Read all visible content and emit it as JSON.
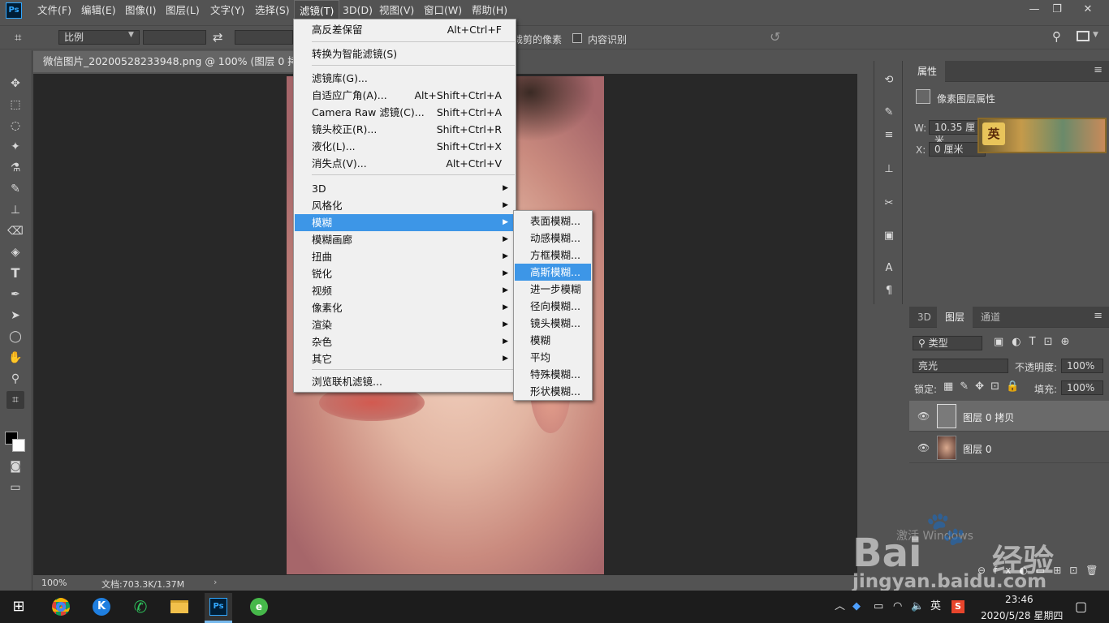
{
  "app": {
    "logo": "Ps"
  },
  "menubar": {
    "items": [
      "文件(F)",
      "编辑(E)",
      "图像(I)",
      "图层(L)",
      "文字(Y)",
      "选择(S)",
      "滤镜(T)",
      "3D(D)",
      "视图(V)",
      "窗口(W)",
      "帮助(H)"
    ]
  },
  "window_controls": {
    "minimize": "—",
    "restore": "❐",
    "close": "✕"
  },
  "options_bar": {
    "ratio_select": "比例",
    "swap_icon": "⇄",
    "delete_pixels_label": "删除裁剪的像素",
    "content_aware_label": "内容识别"
  },
  "document": {
    "tab_title": "微信图片_20200528233948.png @ 100% (图层 0 拷贝, R",
    "zoom": "100%",
    "doc_size": "文档:703.3K/1.37M"
  },
  "filter_menu": {
    "items": [
      {
        "label": "高反差保留",
        "shortcut": "Alt+Ctrl+F"
      },
      {
        "label": "转换为智能滤镜(S)",
        "shortcut": ""
      },
      {
        "label": "滤镜库(G)...",
        "shortcut": ""
      },
      {
        "label": "自适应广角(A)...",
        "shortcut": "Alt+Shift+Ctrl+A"
      },
      {
        "label": "Camera Raw 滤镜(C)...",
        "shortcut": "Shift+Ctrl+A"
      },
      {
        "label": "镜头校正(R)...",
        "shortcut": "Shift+Ctrl+R"
      },
      {
        "label": "液化(L)...",
        "shortcut": "Shift+Ctrl+X"
      },
      {
        "label": "消失点(V)...",
        "shortcut": "Alt+Ctrl+V"
      },
      {
        "label": "3D",
        "submenu": true
      },
      {
        "label": "风格化",
        "submenu": true
      },
      {
        "label": "模糊",
        "submenu": true
      },
      {
        "label": "模糊画廊",
        "submenu": true
      },
      {
        "label": "扭曲",
        "submenu": true
      },
      {
        "label": "锐化",
        "submenu": true
      },
      {
        "label": "视频",
        "submenu": true
      },
      {
        "label": "像素化",
        "submenu": true
      },
      {
        "label": "渲染",
        "submenu": true
      },
      {
        "label": "杂色",
        "submenu": true
      },
      {
        "label": "其它",
        "submenu": true
      },
      {
        "label": "浏览联机滤镜...",
        "shortcut": ""
      }
    ]
  },
  "blur_submenu": {
    "items": [
      "表面模糊...",
      "动感模糊...",
      "方框模糊...",
      "高斯模糊...",
      "进一步模糊",
      "径向模糊...",
      "镜头模糊...",
      "模糊",
      "平均",
      "特殊模糊...",
      "形状模糊..."
    ]
  },
  "properties_panel": {
    "tab": "属性",
    "title": "像素图层属性",
    "w_label": "W:",
    "w_value": "10.35 厘米",
    "x_label": "X:",
    "x_value": "0 厘米",
    "ad_text": "英"
  },
  "layers_panel": {
    "tabs": [
      "3D",
      "图层",
      "通道"
    ],
    "filter_kind": "类型",
    "blend_mode": "亮光",
    "opacity_label": "不透明度:",
    "opacity_value": "100%",
    "lock_label": "锁定:",
    "fill_label": "填充:",
    "fill_value": "100%",
    "layers": [
      {
        "name": "图层 0 拷贝",
        "selected": true
      },
      {
        "name": "图层 0",
        "selected": false
      }
    ]
  },
  "watermark": {
    "activate_text": "激活 Windows",
    "brand_big": "Bai",
    "brand_cn": "经验",
    "url": "jingyan.baidu.com"
  },
  "taskbar": {
    "clock_time": "23:46",
    "clock_date": "2020/5/28 星期四",
    "ime": "英"
  },
  "colors": {
    "accent": "#3d96e7",
    "ps_blue": "#31a8ff",
    "panel": "#535353"
  }
}
